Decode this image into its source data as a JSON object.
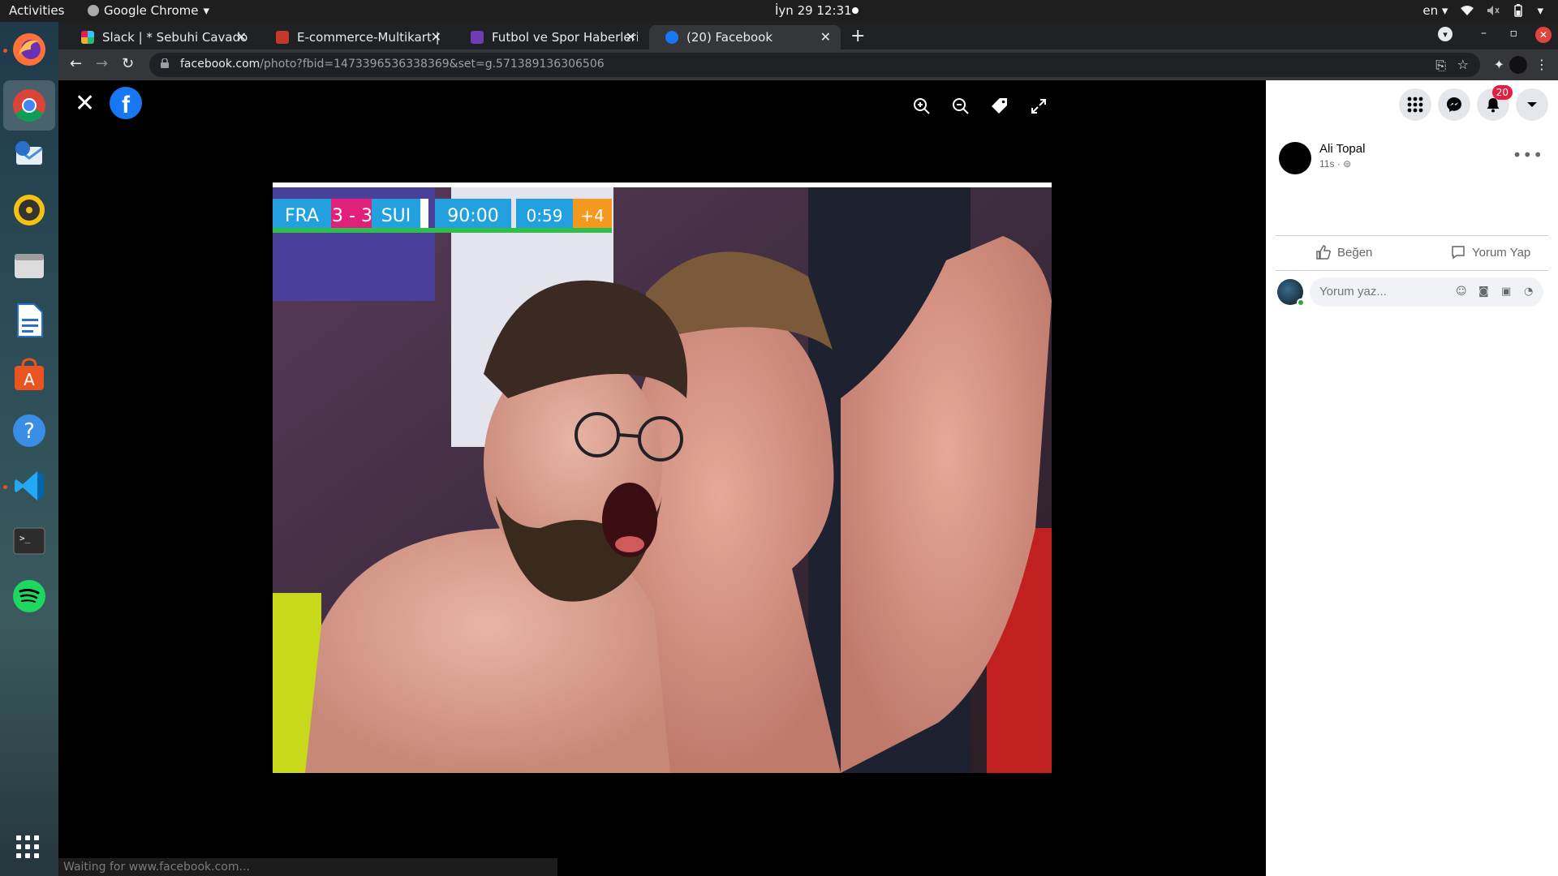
{
  "desktop": {
    "activities_label": "Activities",
    "app_menu_label": "Google Chrome",
    "clock": "İyn 29  12:31",
    "keyboard_layout": "en"
  },
  "dock": {
    "items": [
      {
        "name": "firefox",
        "icon": "firefox-icon",
        "color": "#ff7139"
      },
      {
        "name": "chrome",
        "icon": "chrome-icon",
        "color": "#4285f4"
      },
      {
        "name": "thunderbird",
        "icon": "thunderbird-icon",
        "color": "#4a90d9"
      },
      {
        "name": "rhythmbox",
        "icon": "rhythmbox-icon",
        "color": "#f5c211"
      },
      {
        "name": "files",
        "icon": "files-icon",
        "color": "#cccccc"
      },
      {
        "name": "libreoffice-writer",
        "icon": "writer-icon",
        "color": "#2a6fc9"
      },
      {
        "name": "software",
        "icon": "software-store-icon",
        "color": "#e95420"
      },
      {
        "name": "help",
        "icon": "help-icon",
        "color": "#3a8ee6"
      },
      {
        "name": "vscode",
        "icon": "vscode-icon",
        "color": "#23a9f2"
      },
      {
        "name": "terminal",
        "icon": "terminal-icon",
        "color": "#2c2c2c"
      },
      {
        "name": "spotify",
        "icon": "spotify-icon",
        "color": "#1ed760"
      }
    ]
  },
  "browser": {
    "tabs": [
      {
        "title": "Slack | * Sebuhi Cavadov |",
        "favicon_color": "#e01e5a",
        "active": false
      },
      {
        "title": "E-commerce-Multikart | T",
        "favicon_color": "#c0392b",
        "active": false
      },
      {
        "title": "Futbol ve Spor Haberleri |",
        "favicon_color": "#6a3fb5",
        "active": false
      },
      {
        "title": "(20) Facebook",
        "favicon_color": "#1877f2",
        "active": true
      }
    ],
    "url_domain": "facebook.com",
    "url_path": "/photo?fbid=1473396536338369&set=g.571389136306506",
    "status_text": "Waiting for www.facebook.com..."
  },
  "viewer": {
    "logo_letter": "f",
    "scoreboard": {
      "home": "FRA",
      "score": "3 - 3",
      "away": "SUI",
      "time": "90:00",
      "added_clock": "0:59",
      "added": "+4"
    }
  },
  "panel": {
    "notification_count": "20",
    "author_name": "Ali Topal",
    "post_time": "11s ·",
    "like_label": "Beğen",
    "comment_label": "Yorum Yap",
    "comment_placeholder": "Yorum yaz..."
  },
  "colors": {
    "facebook_blue": "#1877f2",
    "badge_red": "#e41e3f",
    "online_green": "#31a24c"
  }
}
